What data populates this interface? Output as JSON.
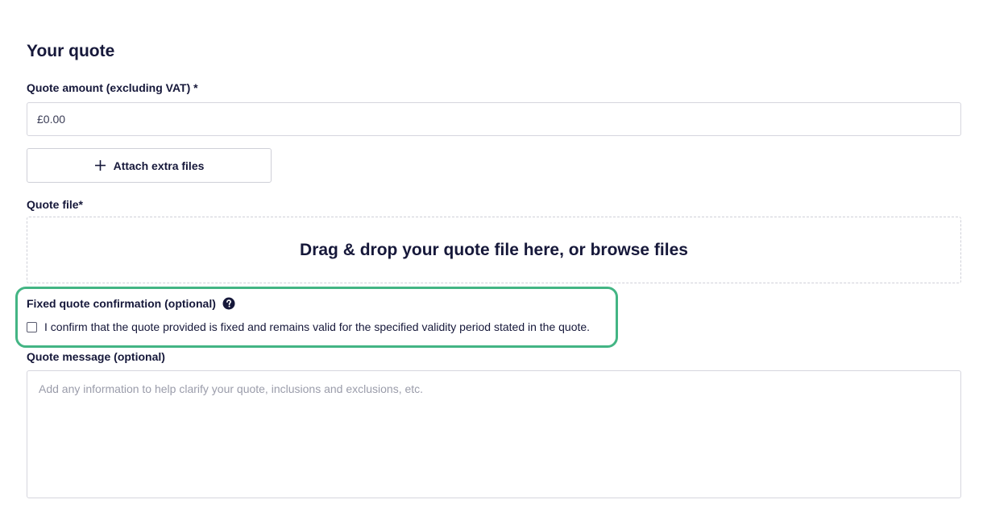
{
  "section": {
    "title": "Your quote"
  },
  "amount": {
    "label": "Quote amount (excluding VAT) *",
    "placeholder": "£0.00"
  },
  "attach": {
    "label": "Attach extra files",
    "icon": "plus-icon"
  },
  "quote_file": {
    "label": "Quote file*",
    "dropzone_text": "Drag & drop your quote file here, or browse files"
  },
  "fixed_quote": {
    "label": "Fixed quote confirmation (optional)",
    "help_icon": "question-circle-icon",
    "checkbox_label": "I confirm that the quote provided is fixed and remains valid for the specified validity period stated in the quote.",
    "checked": false,
    "highlight_color": "#43b584"
  },
  "message": {
    "label": "Quote message (optional)",
    "placeholder": "Add any information to help clarify your quote, inclusions and exclusions, etc."
  }
}
